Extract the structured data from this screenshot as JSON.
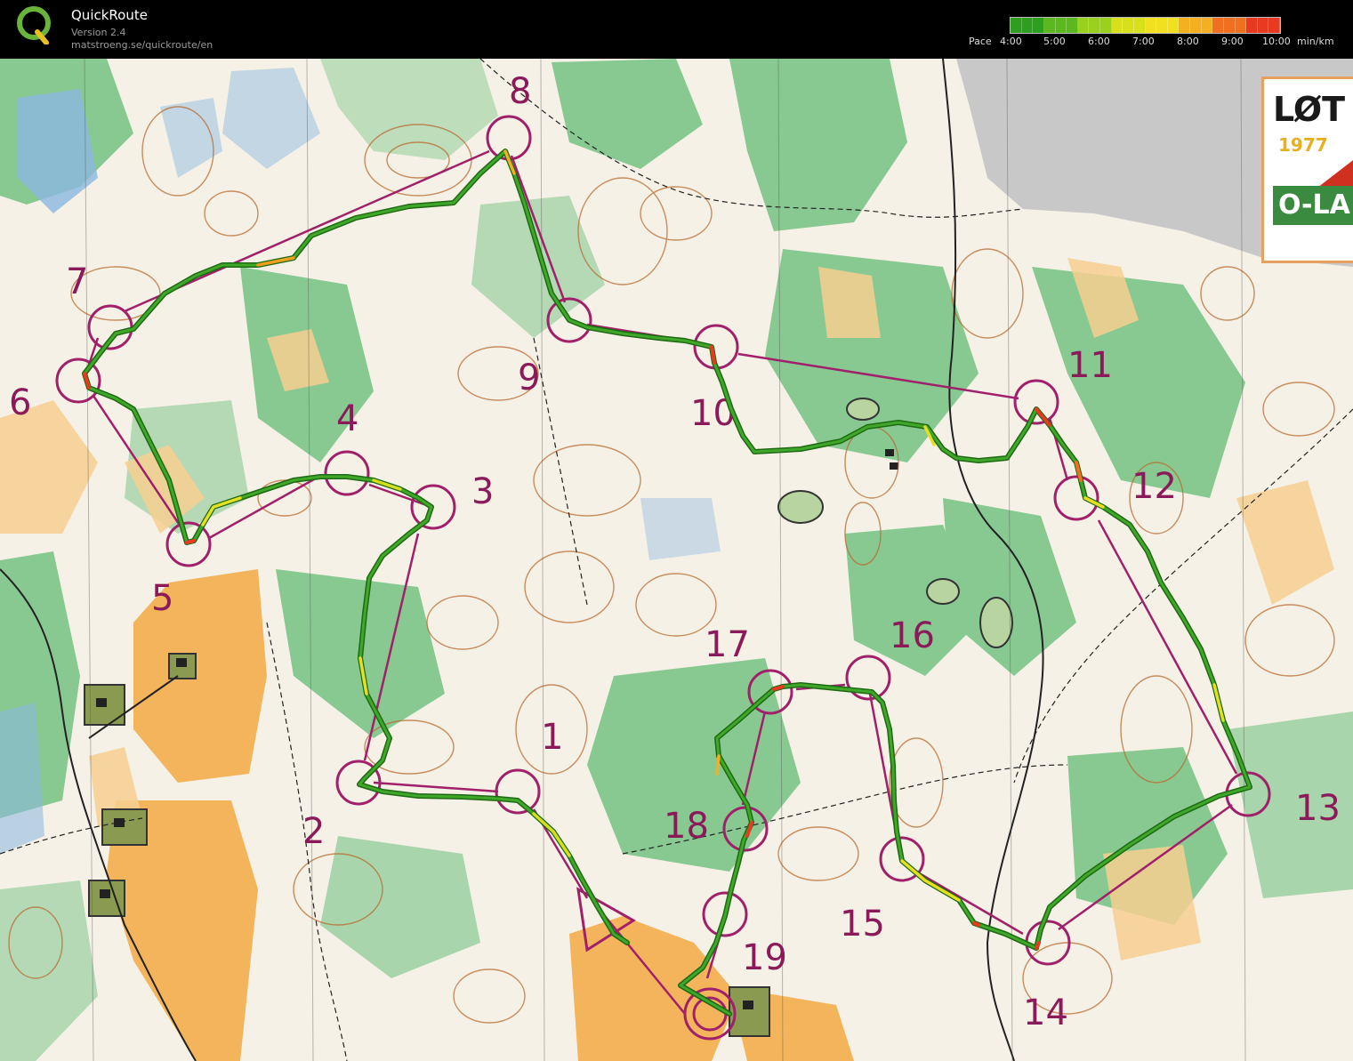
{
  "app": {
    "title": "QuickRoute",
    "version": "Version 2.4",
    "url": "matstroeng.se/quickroute/en"
  },
  "pace_scale": {
    "label": "Pace",
    "ticks": [
      "4:00",
      "5:00",
      "6:00",
      "7:00",
      "8:00",
      "9:00",
      "10:00"
    ],
    "unit": "min/km",
    "colors": [
      "#2e9e1e",
      "#5cb81e",
      "#9ad01e",
      "#d8e01e",
      "#f0e020",
      "#f4b020",
      "#f07020",
      "#e83a20"
    ]
  },
  "map": {
    "legend_text": "LØT",
    "legend_year": "1977",
    "legend_club": "O-LA",
    "controls": [
      "1",
      "2",
      "3",
      "4",
      "5",
      "6",
      "7",
      "8",
      "9",
      "10",
      "11",
      "12",
      "13",
      "14",
      "15",
      "16",
      "17",
      "18",
      "19"
    ],
    "colors": {
      "course": "#a0206a",
      "route": "#2e8a1e",
      "open": "#f4b860",
      "forest": "#6cbf7a",
      "water": "#8ab8e0",
      "contour": "#b86a30"
    }
  }
}
